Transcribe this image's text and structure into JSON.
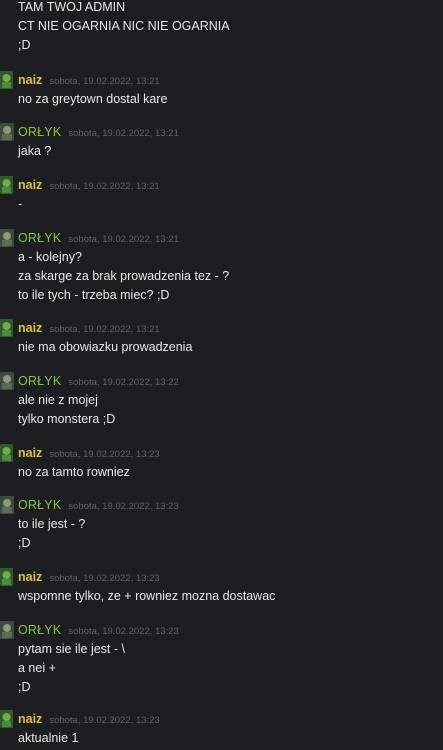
{
  "top_lines": [
    "TAM TWOJ ADMIN",
    "CT NIE OGARNIA NIC NIE OGARNIA",
    ";D"
  ],
  "messages": [
    {
      "author": "naiz",
      "time": "sobota, 19.02.2022, 13:21",
      "lines": [
        "no za greytown dostal kare"
      ]
    },
    {
      "author": "ORŁYK",
      "time": "sobota, 19.02.2022, 13:21",
      "lines": [
        "jaka ?"
      ]
    },
    {
      "author": "naiz",
      "time": "sobota, 19.02.2022, 13:21",
      "lines": [
        "-"
      ]
    },
    {
      "author": "ORŁYK",
      "time": "sobota, 19.02.2022, 13:21",
      "lines": [
        "a - kolejny?",
        "za skarge za brak prowadzenia tez - ?",
        "to ile tych - trzeba miec? ;D"
      ]
    },
    {
      "author": "naiz",
      "time": "sobota, 19.02.2022, 13:21",
      "lines": [
        "nie ma obowiazku prowadzenia"
      ]
    },
    {
      "author": "ORŁYK",
      "time": "sobota, 19.02.2022, 13:22",
      "lines": [
        "ale nie z mojej",
        "tylko monstera ;D"
      ]
    },
    {
      "author": "naiz",
      "time": "sobota, 19.02.2022, 13:23",
      "lines": [
        "no za tamto rowniez"
      ]
    },
    {
      "author": "ORŁYK",
      "time": "sobota, 19.02.2022, 13:23",
      "lines": [
        "to ile jest - ?",
        ";D"
      ]
    },
    {
      "author": "naiz",
      "time": "sobota, 19.02.2022, 13:23",
      "lines": [
        "wspomne tylko, ze + rowniez mozna dostawac"
      ]
    },
    {
      "author": "ORŁYK",
      "time": "sobota, 19.02.2022, 13:23",
      "lines": [
        "pytam sie ile jest - \\",
        "a nei +",
        ";D"
      ]
    },
    {
      "author": "naiz",
      "time": "sobota, 19.02.2022, 13:23",
      "lines": [
        "aktualnie 1"
      ]
    }
  ]
}
